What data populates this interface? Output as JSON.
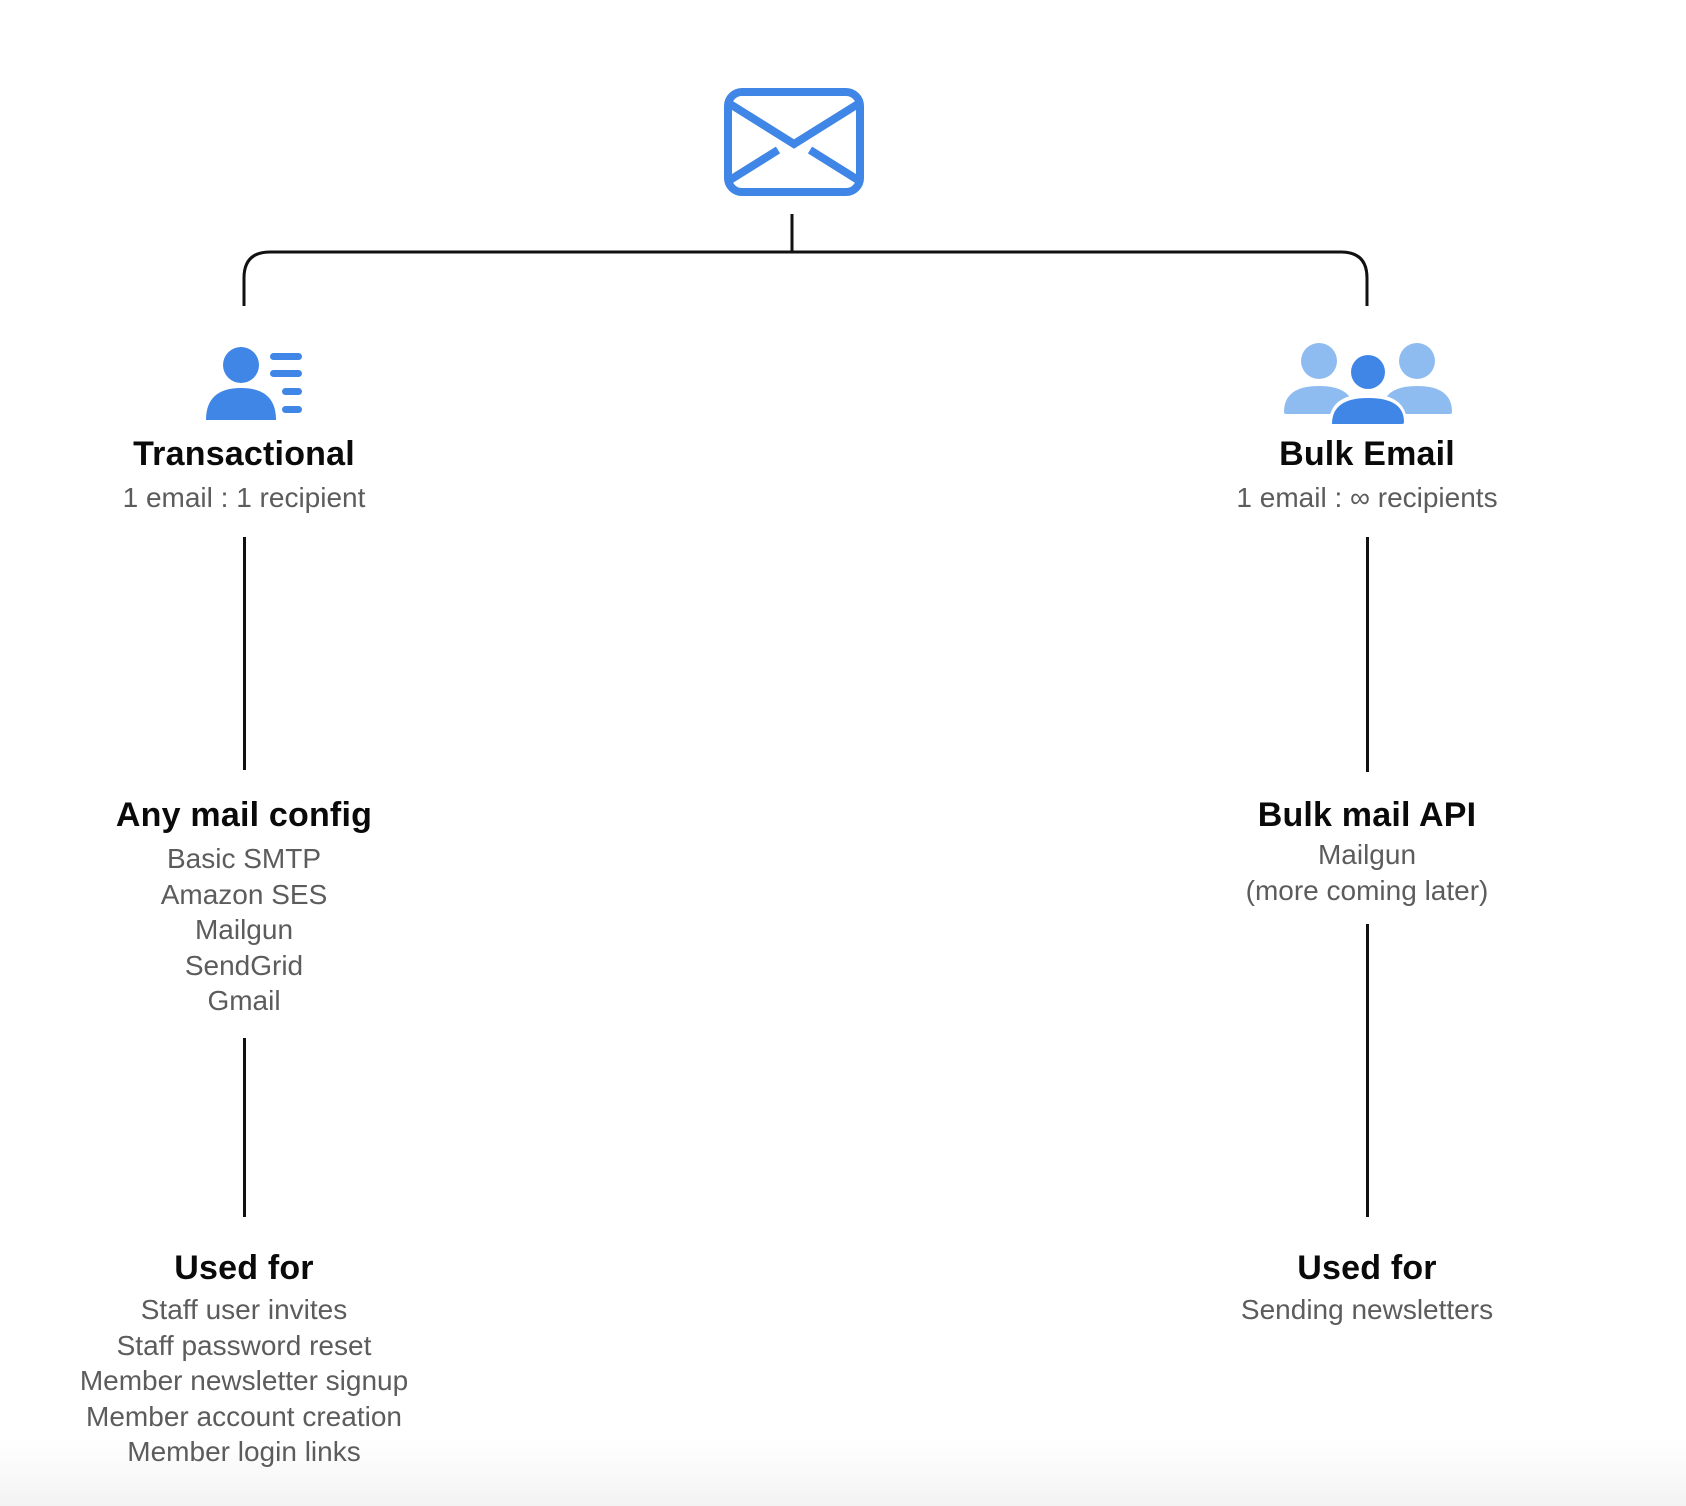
{
  "diagram": {
    "root": {
      "icon": "envelope-icon",
      "color": "#3f86e6"
    },
    "branches": [
      {
        "id": "transactional",
        "icon": "person-with-list-icon",
        "title": "Transactional",
        "subtitle": "1 email : 1 recipient",
        "config": {
          "title": "Any mail config",
          "items": [
            "Basic SMTP",
            "Amazon SES",
            "Mailgun",
            "SendGrid",
            "Gmail"
          ]
        },
        "used_for": {
          "title": "Used for",
          "items": [
            "Staff user invites",
            "Staff password reset",
            "Member newsletter signup",
            "Member account creation",
            "Member login links"
          ]
        }
      },
      {
        "id": "bulk",
        "icon": "group-of-people-icon",
        "title": "Bulk Email",
        "subtitle": "1 email : ∞ recipients",
        "config": {
          "title": "Bulk mail API",
          "items": [
            "Mailgun",
            "(more coming later)"
          ]
        },
        "used_for": {
          "title": "Used for",
          "items": [
            "Sending newsletters"
          ]
        }
      }
    ],
    "colors": {
      "icon_primary": "#3f86e6",
      "icon_light": "#8fbcf0",
      "line": "#111111",
      "text_muted": "#5c5c5c"
    }
  }
}
